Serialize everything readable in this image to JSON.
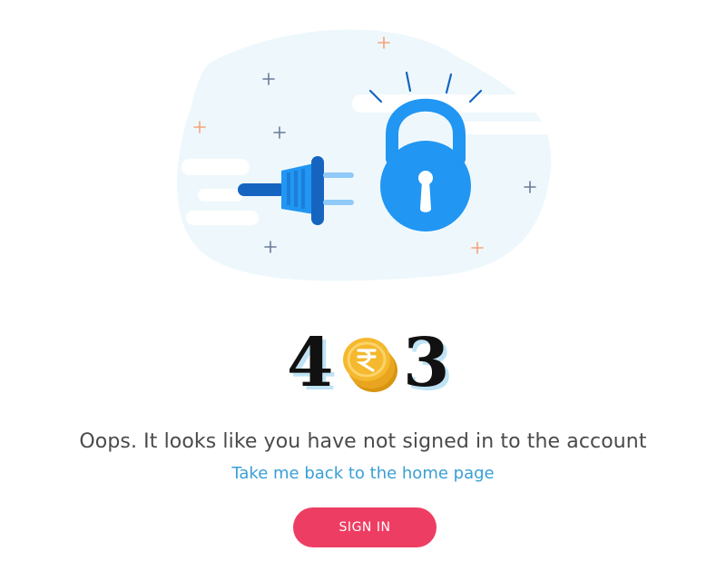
{
  "error": {
    "code_first_digit": "4",
    "code_last_digit": "3",
    "middle_coin_icon": "rupee-coin-icon",
    "message": "Oops. It looks like you have not signed in to the account",
    "home_link": "Take me back to the home page",
    "sign_in_label": "SIGN IN"
  },
  "illustration": {
    "icons": [
      "plug-icon",
      "padlock-icon",
      "sparkle-icon"
    ]
  },
  "colors": {
    "accent_blue": "#2196f3",
    "dark_blue": "#1565c0",
    "link_blue": "#3a9fd6",
    "button_pink": "#ee3d63",
    "coin_gold": "#f5b82e",
    "blob_bg": "#eef8fc",
    "sparkle_orange": "#f5a27a",
    "sparkle_gray": "#6b7b9a"
  }
}
